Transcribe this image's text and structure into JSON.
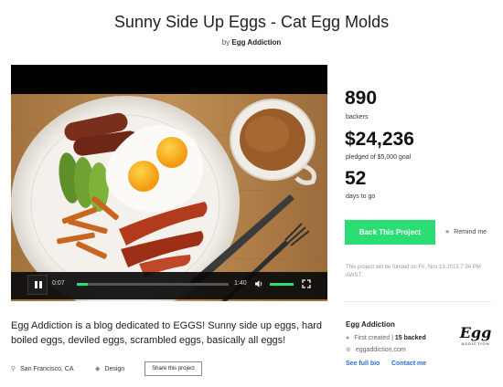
{
  "project": {
    "title": "Sunny Side Up Eggs - Cat Egg Molds",
    "by_prefix": "by",
    "creator": "Egg Addiction"
  },
  "video": {
    "current_time": "0:07",
    "total_time": "1:40",
    "progress_fraction": 0.07,
    "volume_fraction": 1.0,
    "state": "playing"
  },
  "stats": {
    "backers": "890",
    "backers_label": "backers",
    "pledged": "$24,236",
    "pledged_label": "pledged of $5,000 goal",
    "days": "52",
    "days_label": "days to go"
  },
  "actions": {
    "back_label": "Back This Project",
    "remind_label": "Remind me",
    "funded_note": "This project will be funded on Fri, Nov 13 2015 7:34 PM AWST."
  },
  "blurb": "Egg Addiction is a blog dedicated to EGGS! Sunny side up eggs, hard boiled eggs, deviled eggs, scrambled eggs, basically all eggs!",
  "meta": {
    "location": "San Francisco, CA",
    "category": "Design",
    "share_label": "Share this project"
  },
  "creator_card": {
    "name": "Egg Addiction",
    "first_created": "First created",
    "backed": "15 backed",
    "website": "eggaddiction.com",
    "full_bio": "See full bio",
    "contact": "Contact me",
    "logo_text": "Egg",
    "logo_sub": "ADDICTION"
  },
  "colors": {
    "accent_green": "#2bde73",
    "link_blue": "#2a6fcf"
  },
  "icons": [
    "pause-icon",
    "volume-icon",
    "fullscreen-icon",
    "star-icon",
    "location-icon",
    "tag-icon",
    "globe-icon",
    "user-icon"
  ]
}
